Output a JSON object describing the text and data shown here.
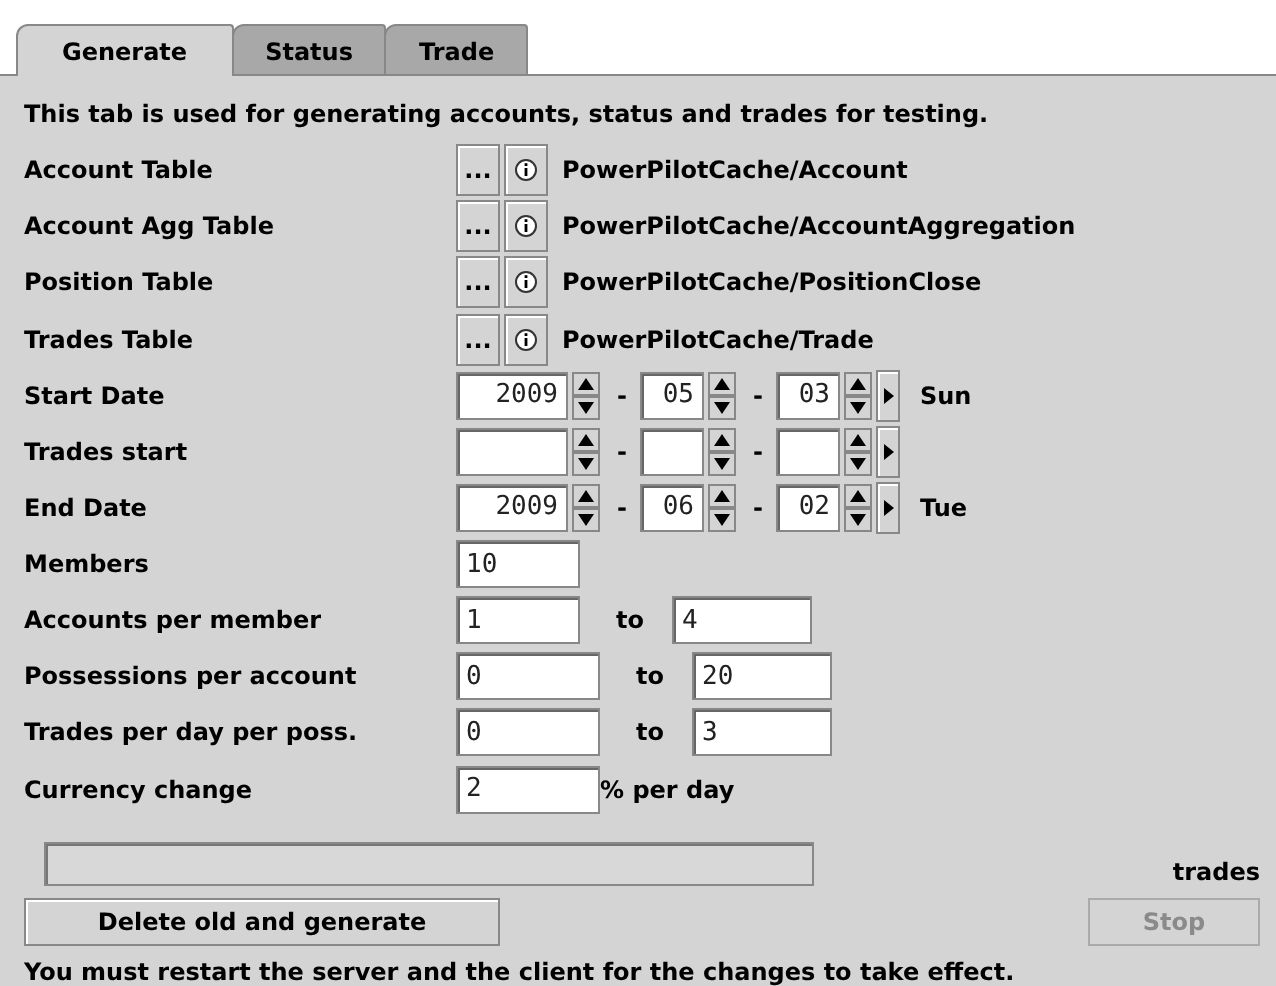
{
  "tabs": [
    {
      "label": "Generate",
      "selected": true
    },
    {
      "label": "Status",
      "selected": false
    },
    {
      "label": "Trade",
      "selected": false
    }
  ],
  "description": "This tab is used for generating accounts, status and trades for testing.",
  "tables": [
    {
      "label": "Account Table",
      "browse": "...",
      "path": "PowerPilotCache/Account"
    },
    {
      "label": "Account Agg Table",
      "browse": "...",
      "path": "PowerPilotCache/AccountAggregation"
    },
    {
      "label": "Position Table",
      "browse": "...",
      "path": "PowerPilotCache/PositionClose"
    },
    {
      "label": "Trades Table",
      "browse": "...",
      "path": "PowerPilotCache/Trade"
    }
  ],
  "dates": [
    {
      "label": "Start Date",
      "year": "2009",
      "month": "05",
      "day": "03",
      "separators": [
        "-",
        "-"
      ],
      "weekday": "Sun"
    },
    {
      "label": "Trades start",
      "separators": [
        "-",
        "-"
      ]
    },
    {
      "label": "End Date",
      "year": "2009",
      "month": "06",
      "day": "02",
      "separators": [
        "-",
        "-"
      ],
      "weekday": "Tue"
    }
  ],
  "fields": [
    {
      "kind": "single",
      "label": "Members",
      "value": "10"
    },
    {
      "kind": "range",
      "label": "Accounts per member",
      "value": "1",
      "to_label": "to",
      "to_value": "4"
    },
    {
      "kind": "range",
      "label": "Possessions per account",
      "value": "0",
      "to_label": "to",
      "to_value": "20"
    },
    {
      "kind": "range",
      "label": "Trades per day per poss.",
      "value": "0",
      "to_label": "to",
      "to_value": "3"
    },
    {
      "kind": "suffix",
      "label": "Currency change",
      "value": "2",
      "suffix": "% per day"
    }
  ],
  "progress": {
    "unit": "trades"
  },
  "buttons": [
    {
      "label": "Delete old and generate",
      "disabled": false
    },
    {
      "label": "Stop",
      "disabled": true
    }
  ],
  "footer": "You must restart the server and the client for the changes to take effect."
}
